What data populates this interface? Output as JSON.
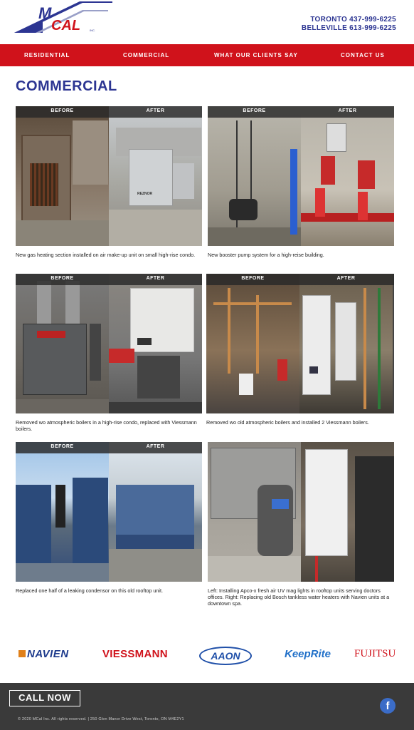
{
  "header": {
    "logo_text": "MCAL",
    "logo_sub": "INC.",
    "phone_toronto": "TORONTO 437-999-6225",
    "phone_belleville": "BELLEVILLE 613-999-6225"
  },
  "nav": {
    "items": [
      {
        "label": "RESIDENTIAL"
      },
      {
        "label": "COMMERCIAL"
      },
      {
        "label": "WHAT OUR CLIENTS SAY"
      },
      {
        "label": "CONTACT US"
      }
    ]
  },
  "main": {
    "title": "COMMERCIAL",
    "before_label": "BEFORE",
    "after_label": "AFTER",
    "projects": [
      {
        "caption": "New gas heating section installed on air make-up unit on small high-rise condo.",
        "unit_brand": "REZNOR"
      },
      {
        "caption": "New booster pump system for a high-reise building."
      },
      {
        "caption": "Removed wo atmospheric boilers in a high-rise condo, replaced with Viessmann boilers."
      },
      {
        "caption": "Removed wo old atmospheric boilers and installed 2 Viessmann boilers."
      },
      {
        "caption": "Replaced one half of a leaking condensor on this old rooftop unit."
      },
      {
        "caption": "Left: Installing Apco-x fresh air UV mag lights in rooftop units serving doctors offices. Right: Replacing old Bosch tankless water heaters with Navien units at a downtown spa."
      }
    ]
  },
  "brands": {
    "items": [
      {
        "name": "NAVIEN"
      },
      {
        "name": "VIESSMANN"
      },
      {
        "name": "AAON"
      },
      {
        "name": "KeepRite"
      },
      {
        "name": "FUJITSU"
      }
    ]
  },
  "footer": {
    "call_now": "CALL NOW",
    "facebook": "f",
    "copyright": "© 2020 MCal Inc. All rights reserved. | 250 Glen Manor Drive West, Toronto, ON M4E2Y1"
  },
  "colors": {
    "brand_blue": "#2c3592",
    "nav_red": "#d0121b",
    "footer_grey": "#3a3a3a"
  }
}
